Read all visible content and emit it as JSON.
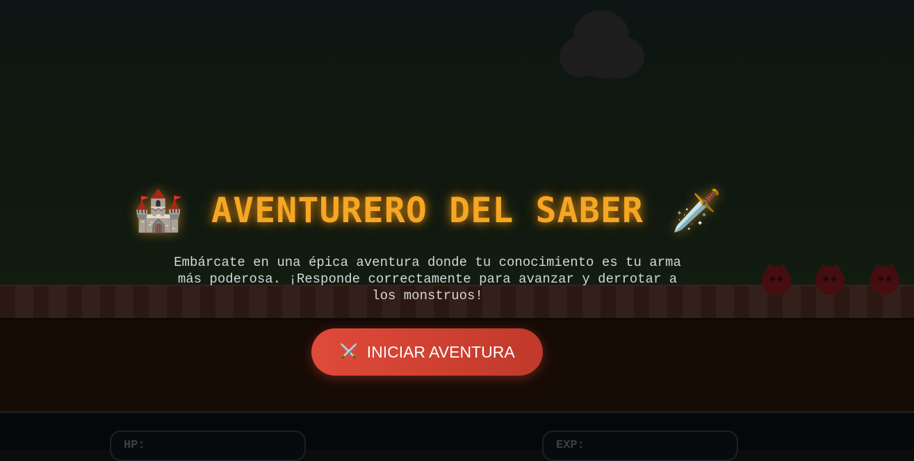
{
  "title": {
    "icon_left": "castle-icon",
    "icon_left_glyph": "🏰",
    "text": "AVENTURERO DEL SABER",
    "icon_right": "dagger-icon",
    "icon_right_glyph": "🗡️"
  },
  "subtitle": "Embárcate en una épica aventura donde tu conocimiento es tu arma más poderosa. ¡Responde correctamente para avanzar y derrotar a los monstruos!",
  "start_button": {
    "icon": "crossed-swords-icon",
    "icon_glyph": "⚔️",
    "label": "INICIAR AVENTURA"
  },
  "hud": {
    "hp_label": "HP:",
    "exp_label": "EXP:"
  },
  "colors": {
    "title": "#f5a623",
    "button": "#e04a3a",
    "background": "#0d1614"
  }
}
